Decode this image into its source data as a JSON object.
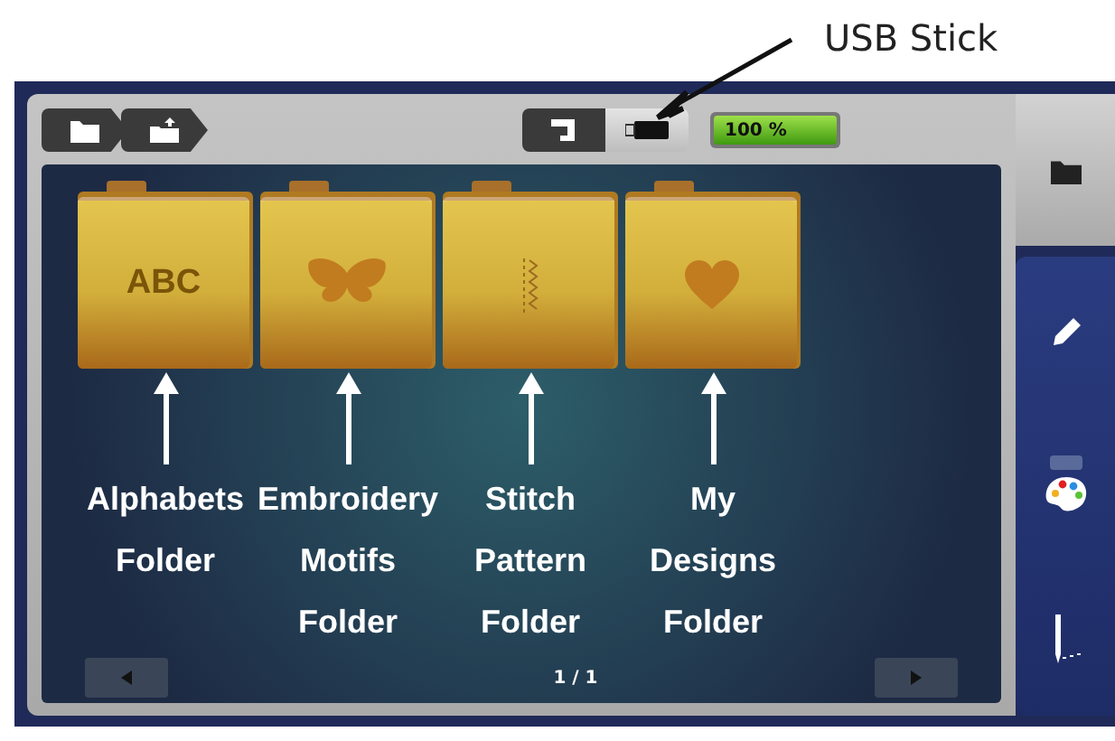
{
  "annotation": {
    "text": "USB Stick"
  },
  "breadcrumb": [
    {
      "kind": "folder"
    },
    {
      "kind": "folder-up"
    }
  ],
  "source_toggle": [
    {
      "kind": "machine",
      "selected": false
    },
    {
      "kind": "usb",
      "selected": true
    }
  ],
  "capacity": {
    "text": "100 %",
    "level": 1
  },
  "folders": [
    {
      "kind": "alphabets",
      "icon_text": "ABC",
      "label": "Alphabets Folder"
    },
    {
      "kind": "motifs",
      "label": "Embroidery Motifs Folder"
    },
    {
      "kind": "stitch",
      "label": "Stitch Pattern Folder"
    },
    {
      "kind": "designs",
      "label": "My Designs Folder"
    }
  ],
  "pager": {
    "text": "1 / 1"
  },
  "sidebar": [
    {
      "kind": "folder",
      "selected": true
    },
    {
      "kind": "pencil",
      "selected": false
    },
    {
      "kind": "palette",
      "selected": false
    },
    {
      "kind": "needle",
      "selected": false
    }
  ]
}
